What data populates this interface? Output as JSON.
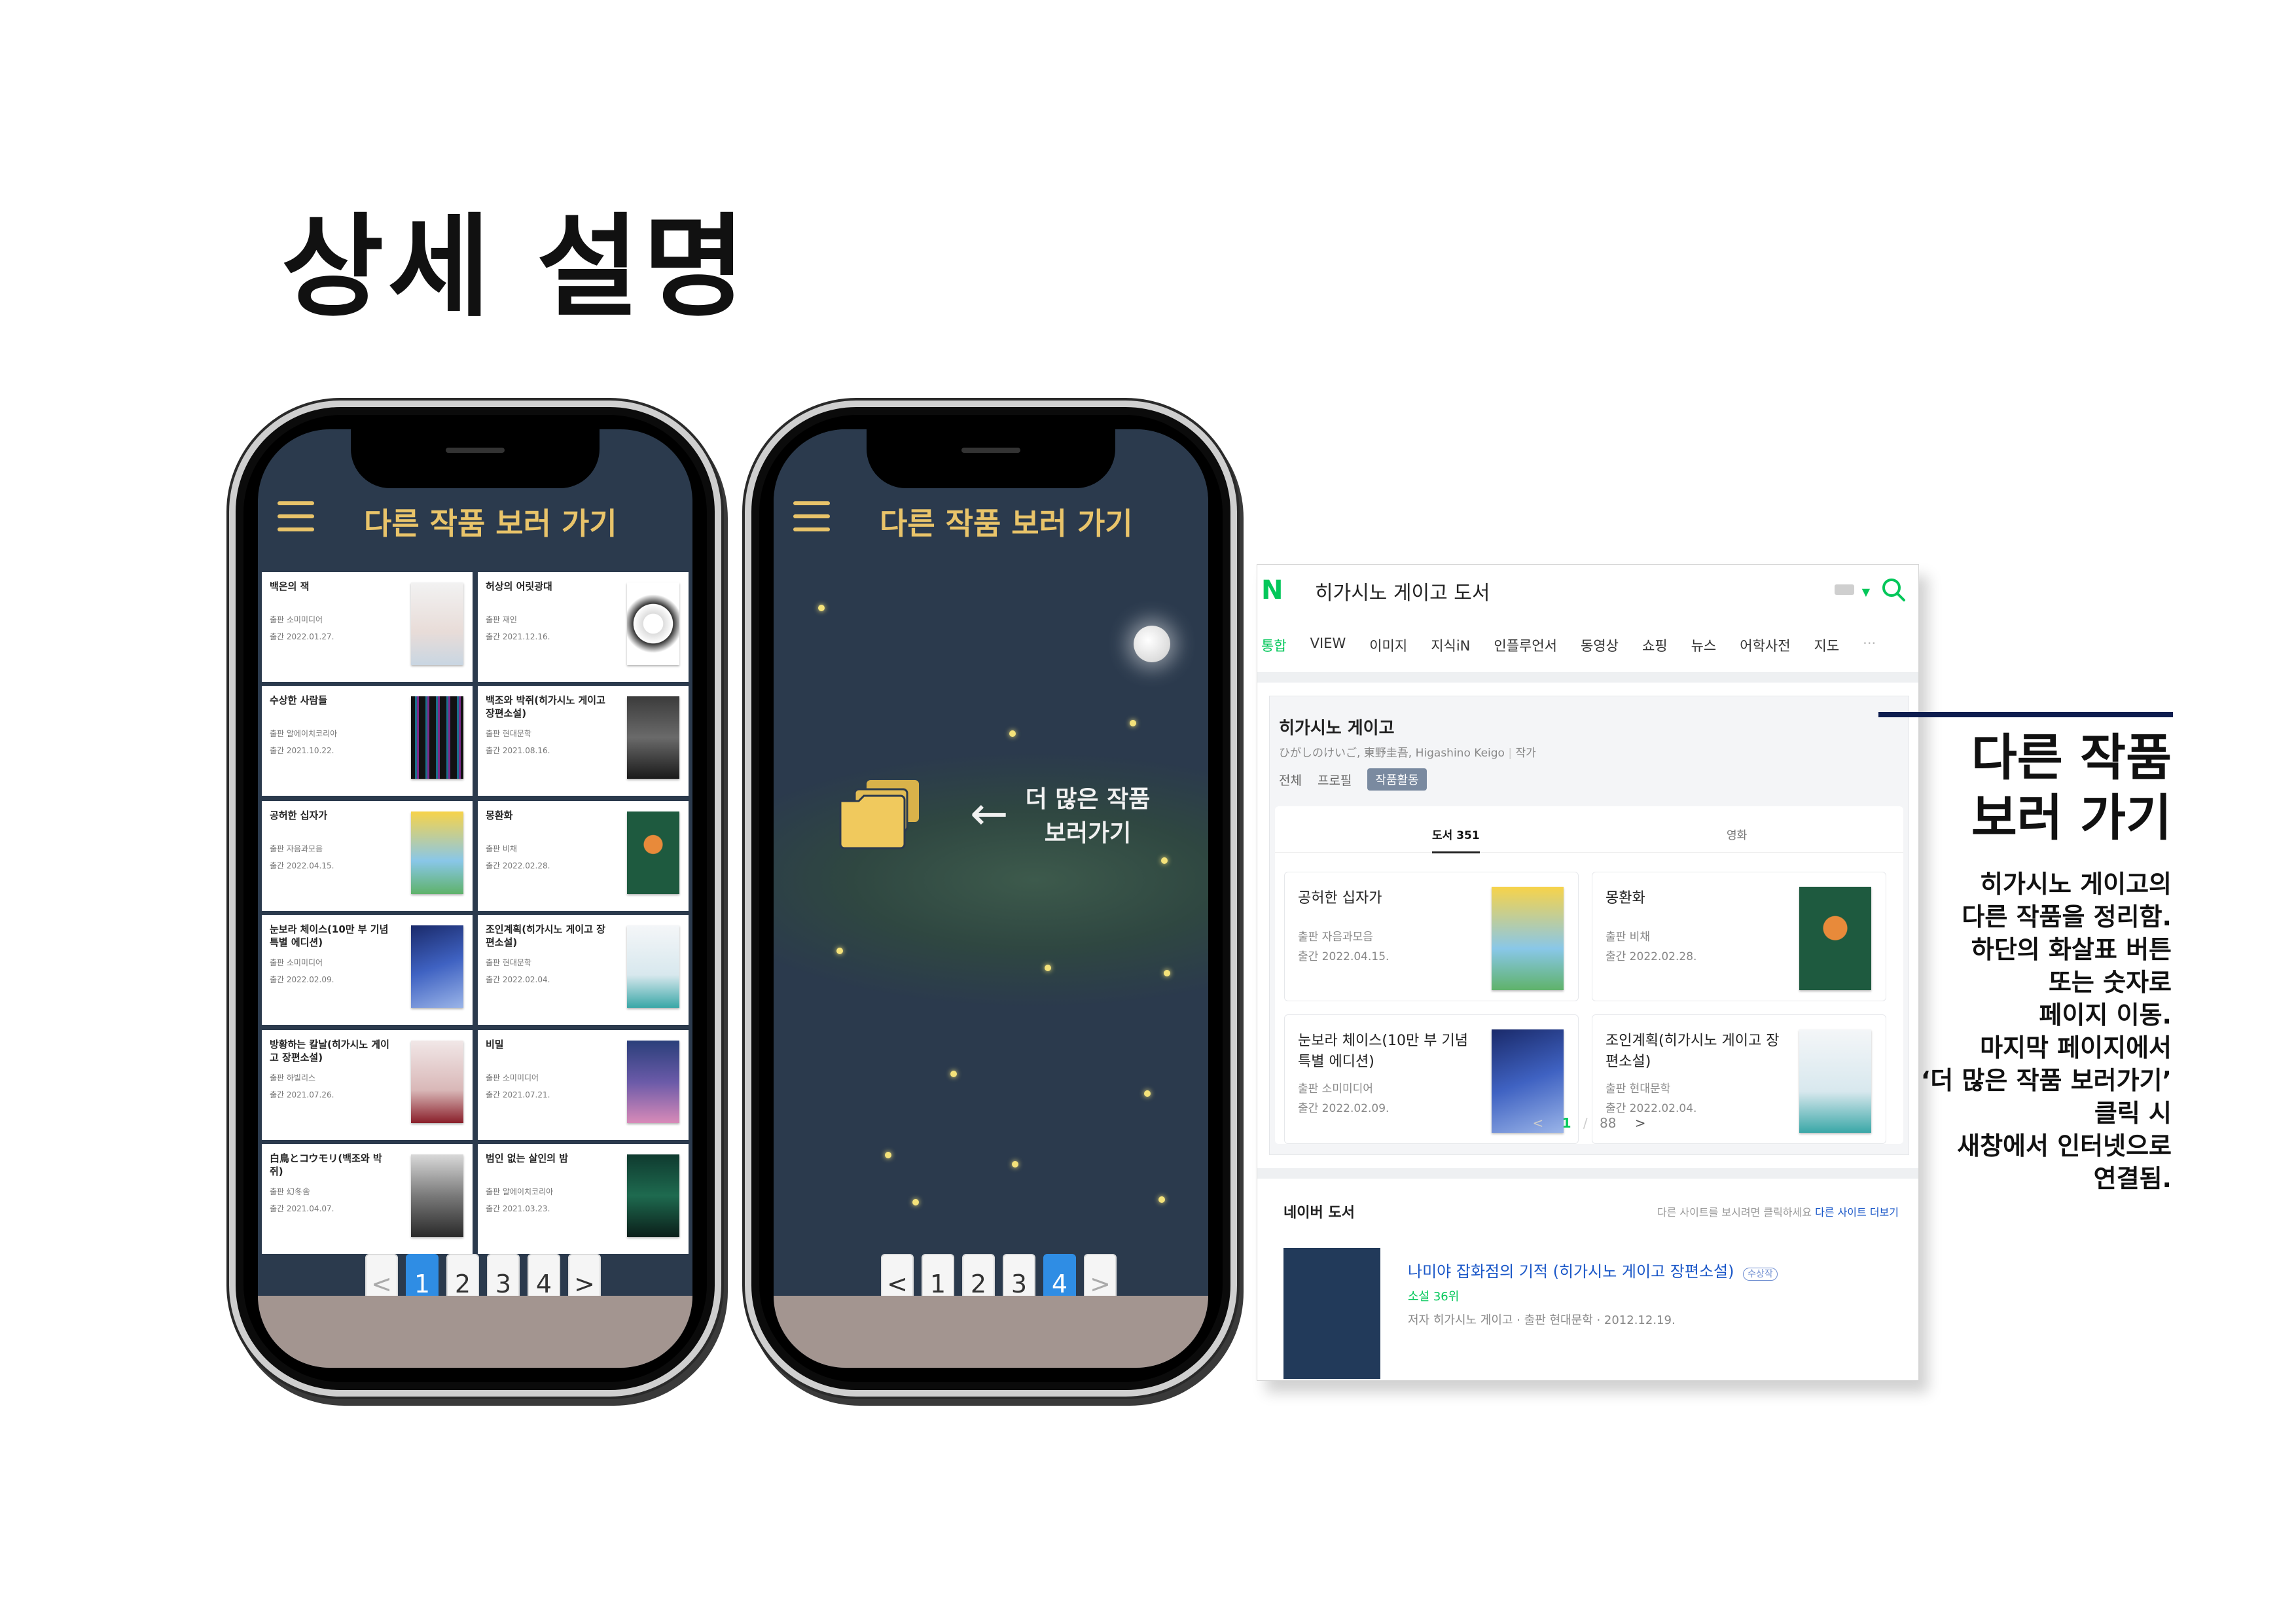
{
  "page": {
    "title": "상세 설명"
  },
  "phone1": {
    "header": "다른 작품 보러 가기",
    "books": [
      {
        "title": "백은의 잭",
        "publisher": "출판 소미미디어",
        "date": "출간 2022.01.27."
      },
      {
        "title": "허상의 어릿광대",
        "publisher": "출판 재인",
        "date": "출간 2021.12.16."
      },
      {
        "title": "수상한 사람들",
        "publisher": "출판 알에이치코리아",
        "date": "출간 2021.10.22."
      },
      {
        "title": "백조와 박쥐(히가시노 게이고 장편소설)",
        "publisher": "출판 현대문학",
        "date": "출간 2021.08.16."
      },
      {
        "title": "공허한 십자가",
        "publisher": "출판 자음과모음",
        "date": "출간 2022.04.15."
      },
      {
        "title": "몽환화",
        "publisher": "출판 비채",
        "date": "출간 2022.02.28."
      },
      {
        "title": "눈보라 체이스(10만 부 기념 특별 에디션)",
        "publisher": "출판 소미미디어",
        "date": "출간 2022.02.09."
      },
      {
        "title": "조인계획(히가시노 게이고 장편소설)",
        "publisher": "출판 현대문학",
        "date": "출간 2022.02.04."
      },
      {
        "title": "방황하는 칼날(히가시노 게이고 장편소설)",
        "publisher": "출판 하빌리스",
        "date": "출간 2021.07.26."
      },
      {
        "title": "비밀",
        "publisher": "출판 소미미디어",
        "date": "출간 2021.07.21."
      },
      {
        "title": "白鳥とコウモリ(백조와 박쥐)",
        "publisher": "출판 幻冬舎",
        "date": "출간 2021.04.07."
      },
      {
        "title": "범인 없는 살인의 밤",
        "publisher": "출판 알에이치코리아",
        "date": "출간 2021.03.23."
      }
    ],
    "pager": {
      "prev": "<",
      "pages": [
        "1",
        "2",
        "3",
        "4"
      ],
      "next": ">",
      "active": "1"
    }
  },
  "phone2": {
    "header": "다른 작품 보러 가기",
    "arrow": "←",
    "more_line1": "더 많은 작품",
    "more_line2": "보러가기",
    "pager": {
      "prev": "<",
      "pages": [
        "1",
        "2",
        "3",
        "4"
      ],
      "next": ">",
      "active": "4"
    }
  },
  "naver": {
    "logo": "N",
    "query": "히가시노 게이고 도서",
    "tabs": [
      "통합",
      "VIEW",
      "이미지",
      "지식iN",
      "인플루언서",
      "동영상",
      "쇼핑",
      "뉴스",
      "어학사전",
      "지도"
    ],
    "active_tab": "통합",
    "more_dots": "···",
    "author": "히가시노 게이고",
    "author_sub": "ひがしのけいご, 東野圭吾, Higashino Keigo",
    "author_role": "작가",
    "author_tabs": [
      "전체",
      "프로필"
    ],
    "author_tab_active": "작품활동",
    "subtabs": [
      "도서 351",
      "영화"
    ],
    "books": [
      {
        "title": "공허한 십자가",
        "publisher": "출판  자음과모음",
        "date": "출간  2022.04.15."
      },
      {
        "title": "몽환화",
        "publisher": "출판  비채",
        "date": "출간  2022.02.28."
      },
      {
        "title": "눈보라 체이스(10만 부 기념 특별 에디션)",
        "publisher": "출판  소미미디어",
        "date": "출간  2022.02.09."
      },
      {
        "title": "조인계획(히가시노 게이고 장편소설)",
        "publisher": "출판  현대문학",
        "date": "출간  2022.02.04."
      }
    ],
    "pager": {
      "current": "1",
      "separator": "/",
      "total": "88"
    },
    "section_title": "네이버 도서",
    "section_hint": "다른 사이트를 보시려면 클릭하세요",
    "section_link": "다른 사이트 더보기",
    "result_title": "나미야 잡화점의 기적 (히가시노 게이고 장편소설)",
    "result_badge": "수상작",
    "result_rank": "소설 36위",
    "result_meta": "저자 히가시노 게이고 · 출판 현대문학 · 2012.12.19."
  },
  "caption": {
    "title_line1": "다른 작품",
    "title_line2": "보러 가기",
    "body": "히가시노 게이고의\n다른 작품을 정리함.\n하단의 화살표 버튼\n또는 숫자로\n페이지 이동.\n마지막 페이지에서\n‘더 많은 작품 보러가기’\n클릭 시\n새창에서 인터넷으로\n연결됨."
  },
  "colors": {
    "app_bg": "#2b3a4d",
    "accent_yellow": "#e9c46a",
    "pager_active": "#2f8de4",
    "naver_green": "#03c75a",
    "caption_rule": "#0e1d4f"
  }
}
